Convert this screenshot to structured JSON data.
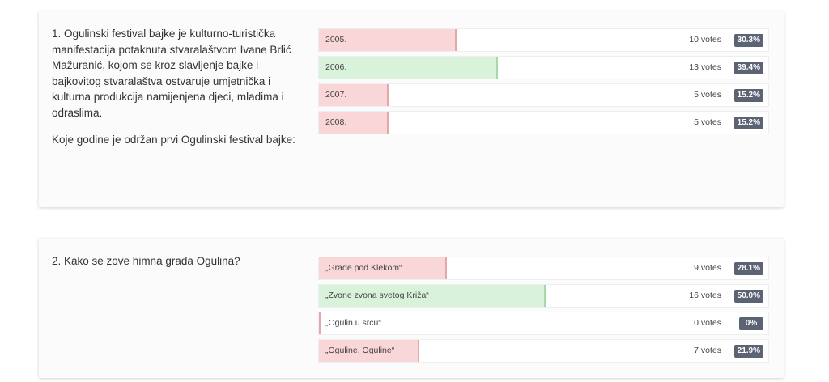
{
  "questions": [
    {
      "paragraph": "1. Ogulinski festival bajke je kulturno-turistička manifestacija potaknuta stvaralaštvom Ivane Brlić Mažuranić, kojom se kroz slavljenje bajke i bajkovitog stvaralaštva ostvaruje umjetnička i kulturna produkcija namijenjena djeci, mladima i odraslima.",
      "prompt": "Koje godine je održan prvi Ogulinski festival bajke:",
      "options": [
        {
          "label": "2005.",
          "votes": "10 votes",
          "percent": "30.3%",
          "fill": 0.303,
          "correct": false
        },
        {
          "label": "2006.",
          "votes": "13 votes",
          "percent": "39.4%",
          "fill": 0.394,
          "correct": true
        },
        {
          "label": "2007.",
          "votes": "5 votes",
          "percent": "15.2%",
          "fill": 0.152,
          "correct": false
        },
        {
          "label": "2008.",
          "votes": "5 votes",
          "percent": "15.2%",
          "fill": 0.152,
          "correct": false
        }
      ]
    },
    {
      "paragraph": "2. Kako se zove himna grada Ogulina?",
      "prompt": "",
      "options": [
        {
          "label": "„Grade pod Klekom“",
          "votes": "9 votes",
          "percent": "28.1%",
          "fill": 0.281,
          "correct": false
        },
        {
          "label": "„Zvone zvona svetog Križa“",
          "votes": "16 votes",
          "percent": "50.0%",
          "fill": 0.5,
          "correct": true
        },
        {
          "label": "„Ogulin u srcu“",
          "votes": "0 votes",
          "percent": "0%",
          "fill": 0.0,
          "correct": false
        },
        {
          "label": "„Oguline, Oguline“",
          "votes": "7 votes",
          "percent": "21.9%",
          "fill": 0.219,
          "correct": false
        }
      ]
    }
  ],
  "colors": {
    "wrong_fill": "#f9d6d8",
    "correct_fill": "#d9f2da",
    "badge": "#5c6373"
  }
}
